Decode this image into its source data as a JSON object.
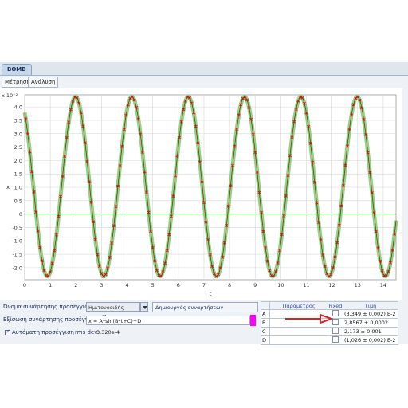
{
  "tabs": [
    {
      "label": "BOMB"
    }
  ],
  "subtabs": [
    {
      "label": "Μέτρηση"
    },
    {
      "label": "Ανάλυση"
    }
  ],
  "chart_data": {
    "type": "scatter",
    "title": "",
    "xlabel": "t",
    "ylabel": "x",
    "y_exponent_label": "x 10⁻²",
    "xlim": [
      0,
      14.5
    ],
    "ylim": [
      -2.45,
      4.45
    ],
    "x_ticks": [
      "0",
      "1",
      "2",
      "3",
      "4",
      "5",
      "6",
      "7",
      "8",
      "9",
      "10",
      "11",
      "12",
      "13",
      "14"
    ],
    "y_ticks": [
      "4,0",
      "3,5",
      "3,0",
      "2,5",
      "2,0",
      "1,5",
      "1,0",
      "0,5",
      "0",
      "-0,5",
      "-1,0",
      "-1,5",
      "-2,0"
    ],
    "grid": true,
    "series": [
      {
        "kind": "measured",
        "color": "#d62020",
        "marker": "x"
      },
      {
        "kind": "fit",
        "color": "#6fd36f"
      }
    ],
    "fit_params": {
      "A": 3.349,
      "B": 2.8567,
      "C": 2.173,
      "D": 1.026
    }
  },
  "lower": {
    "fn_name_label": "Όνομα συνάρτησης προσέγγισης:",
    "fn_name_value": "Ημιτονοειδής καμπύλη",
    "create_button": "Δημιουργός συναρτήσεων προσέγγισης...",
    "equation_label": "Εξίσωση συνάρτησης προσέγγισης:",
    "equation_value": "x = A*sin(B*t+C)+D",
    "auto_label": "Αυτόματη προσέγγιση",
    "rms_label": "rms dev:",
    "rms_value": "3.320e-4"
  },
  "params_table": {
    "headers": [
      "Παράμετρος",
      "Fixed",
      "Τιμή"
    ],
    "rows": [
      {
        "name": "A",
        "value": "(3,349 ± 0,002) E-2"
      },
      {
        "name": "B",
        "value": "2,8567 ± 0,0002"
      },
      {
        "name": "C",
        "value": "2,173 ± 0,001"
      },
      {
        "name": "D",
        "value": "(1,026 ± 0,002) E-2"
      }
    ]
  },
  "annotation": {
    "arrow_color": "#e02020"
  }
}
